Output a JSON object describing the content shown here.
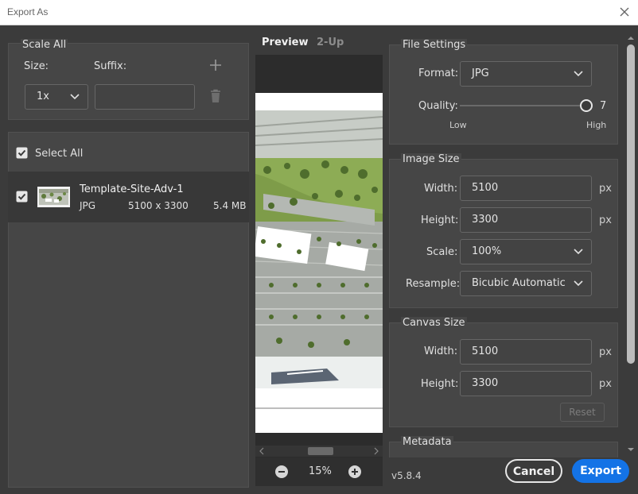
{
  "window": {
    "title": "Export As"
  },
  "scale_all": {
    "heading": "Scale All",
    "size_label": "Size:",
    "suffix_label": "Suffix:",
    "size_value": "1x",
    "suffix_value": ""
  },
  "assets": {
    "select_all_label": "Select All",
    "items": [
      {
        "name": "Template-Site-Adv-1",
        "format": "JPG",
        "dimensions": "5100 x 3300",
        "filesize": "5.4 MB"
      }
    ]
  },
  "preview": {
    "tabs": [
      {
        "label": "Preview"
      },
      {
        "label": "2-Up"
      }
    ],
    "zoom": "15%"
  },
  "file_settings": {
    "heading": "File Settings",
    "format_label": "Format:",
    "format_value": "JPG",
    "quality_label": "Quality:",
    "quality_value": "7",
    "quality_low": "Low",
    "quality_high": "High"
  },
  "image_size": {
    "heading": "Image Size",
    "width_label": "Width:",
    "width_value": "5100",
    "height_label": "Height:",
    "height_value": "3300",
    "unit": "px",
    "scale_label": "Scale:",
    "scale_value": "100%",
    "resample_label": "Resample:",
    "resample_value": "Bicubic Automatic"
  },
  "canvas_size": {
    "heading": "Canvas Size",
    "width_label": "Width:",
    "width_value": "5100",
    "height_label": "Height:",
    "height_value": "3300",
    "unit": "px",
    "reset_label": "Reset"
  },
  "metadata": {
    "heading": "Metadata"
  },
  "footer": {
    "version": "v5.8.4",
    "cancel_label": "Cancel",
    "export_label": "Export",
    "accent": "#1473e6"
  }
}
